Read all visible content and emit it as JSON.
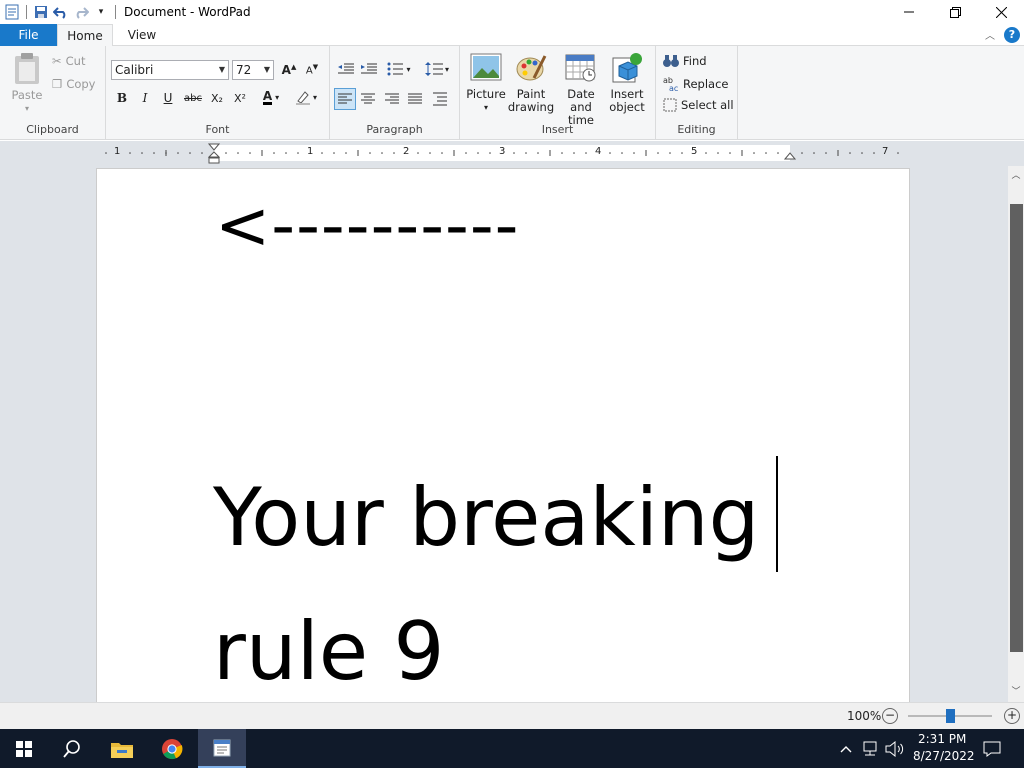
{
  "window": {
    "title": "Document - WordPad"
  },
  "tabs": {
    "file": "File",
    "home": "Home",
    "view": "View"
  },
  "clipboard": {
    "label": "Clipboard",
    "paste": "Paste",
    "cut": "Cut",
    "copy": "Copy"
  },
  "font": {
    "label": "Font",
    "family": "Calibri",
    "size": "72",
    "bold": "B",
    "italic": "I",
    "underline": "U",
    "strike": "abc",
    "subscript": "X₂",
    "superscript": "X²"
  },
  "paragraph": {
    "label": "Paragraph"
  },
  "insert": {
    "label": "Insert",
    "picture": "Picture",
    "paint_line1": "Paint",
    "paint_line2": "drawing",
    "datetime_line1": "Date and",
    "datetime_line2": "time",
    "object_line1": "Insert",
    "object_line2": "object"
  },
  "editing": {
    "label": "Editing",
    "find": "Find",
    "replace": "Replace",
    "select_all": "Select all"
  },
  "ruler": {
    "numbers": [
      "1",
      "1",
      "2",
      "3",
      "4",
      "5",
      "7"
    ]
  },
  "document": {
    "line1": "<----------",
    "line2": "Your breaking",
    "line3": "rule 9"
  },
  "status": {
    "zoom": "100%"
  },
  "taskbar": {
    "time": "2:31 PM",
    "date": "8/27/2022"
  },
  "colors": {
    "accent": "#1979ca",
    "ribbon": "#f5f6f7",
    "taskbar": "#101a2a"
  }
}
